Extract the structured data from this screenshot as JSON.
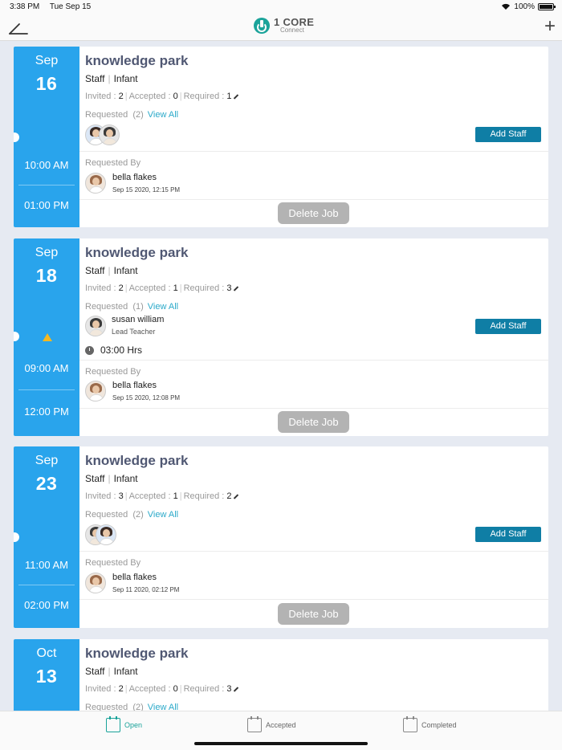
{
  "status_bar": {
    "time": "3:38 PM",
    "date": "Tue Sep 15",
    "battery": "100%"
  },
  "nav": {
    "logo_title": "1 CORE",
    "logo_subtitle": "Connect",
    "back_icon": "back-icon",
    "add_icon": "plus-icon",
    "add_symbol": "+"
  },
  "labels": {
    "invited": "Invited : ",
    "accepted": "Accepted : ",
    "required": "Required : ",
    "requested": "Requested",
    "view_all": "View All",
    "requested_by": "Requested By",
    "add_staff": "Add Staff",
    "delete_job": "Delete Job"
  },
  "jobs": [
    {
      "month": "Sep",
      "day": "16",
      "start_time": "10:00 AM",
      "end_time": "01:00 PM",
      "title": "knowledge park",
      "role": "Staff",
      "age_group": "Infant",
      "invited": "2",
      "accepted": "0",
      "required": "1",
      "requested_count": "(2)",
      "requested_by_name": "bella flakes",
      "requested_by_date": "Sep 15 2020, 12:15 PM"
    },
    {
      "month": "Sep",
      "day": "18",
      "start_time": "09:00 AM",
      "end_time": "12:00 PM",
      "title": "knowledge park",
      "role": "Staff",
      "age_group": "Infant",
      "invited": "2",
      "accepted": "1",
      "required": "3",
      "requested_count": "(1)",
      "staff_name": "susan william",
      "staff_role": "Lead Teacher",
      "hours": "03:00 Hrs",
      "requested_by_name": "bella flakes",
      "requested_by_date": "Sep 15 2020, 12:08 PM"
    },
    {
      "month": "Sep",
      "day": "23",
      "start_time": "11:00 AM",
      "end_time": "02:00 PM",
      "title": "knowledge park",
      "role": "Staff",
      "age_group": "Infant",
      "invited": "3",
      "accepted": "1",
      "required": "2",
      "requested_count": "(2)",
      "requested_by_name": "bella flakes",
      "requested_by_date": "Sep 11 2020, 02:12 PM"
    },
    {
      "month": "Oct",
      "day": "13",
      "title": "knowledge park",
      "role": "Staff",
      "age_group": "Infant",
      "invited": "2",
      "accepted": "0",
      "required": "3",
      "requested_count": "(2)"
    }
  ],
  "tabs": [
    {
      "label": "Open",
      "icon": "calendar-open-icon",
      "active": true
    },
    {
      "label": "Accepted",
      "icon": "calendar-accepted-icon",
      "active": false
    },
    {
      "label": "Completed",
      "icon": "calendar-completed-icon",
      "active": false
    }
  ]
}
